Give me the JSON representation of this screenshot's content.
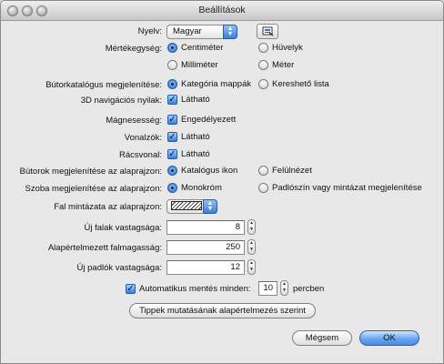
{
  "window": {
    "title": "Beállítások"
  },
  "language": {
    "label": "Nyelv:",
    "value": "Magyar"
  },
  "unit": {
    "label": "Mértékegység:",
    "options": [
      {
        "label": "Centiméter",
        "selected": true
      },
      {
        "label": "Hüvelyk",
        "selected": false
      },
      {
        "label": "Milliméter",
        "selected": false
      },
      {
        "label": "Méter",
        "selected": false
      }
    ]
  },
  "furniture_catalog": {
    "label": "Bútorkatalógus megjelenítése:",
    "options": [
      {
        "label": "Kategória mappák",
        "selected": true
      },
      {
        "label": "Kereshető lista",
        "selected": false
      }
    ]
  },
  "nav_arrows": {
    "label": "3D navigációs nyilak:",
    "check_label": "Látható",
    "checked": true
  },
  "magnetism": {
    "label": "Mágnesesség:",
    "check_label": "Engedélyezett",
    "checked": true
  },
  "rulers": {
    "label": "Vonalzók:",
    "check_label": "Látható",
    "checked": true
  },
  "grid": {
    "label": "Rácsvonal:",
    "check_label": "Látható",
    "checked": true
  },
  "furniture_plan": {
    "label": "Bútorok megjelenítése az alaprajzon:",
    "options": [
      {
        "label": "Katalógus ikon",
        "selected": true
      },
      {
        "label": "Felülnézet",
        "selected": false
      }
    ]
  },
  "room_plan": {
    "label": "Szoba megjelenítése az alaprajzon:",
    "options": [
      {
        "label": "Monokróm",
        "selected": true
      },
      {
        "label": "Padlószín vagy mintázat megjelenítése",
        "selected": false
      }
    ]
  },
  "wall_pattern": {
    "label": "Fal mintázata az alaprajzon:"
  },
  "new_wall_thickness": {
    "label": "Új falak vastagsága:",
    "value": "8"
  },
  "wall_height": {
    "label": "Alapértelmezett falmagasság:",
    "value": "250"
  },
  "floor_thickness": {
    "label": "Új padlók vastagsága:",
    "value": "12"
  },
  "autosave": {
    "label": "Automatikus mentés minden:",
    "value": "10",
    "unit": "percben",
    "checked": true
  },
  "tips_button": {
    "label": "Tippek mutatásának alapértelmezés szerint"
  },
  "cancel_button": {
    "label": "Mégsem"
  },
  "ok_button": {
    "label": "OK"
  }
}
